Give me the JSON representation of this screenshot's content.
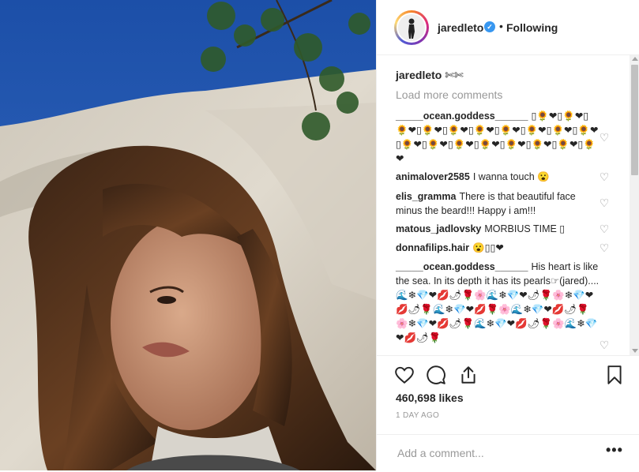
{
  "header": {
    "username": "jaredleto",
    "separator": "•",
    "follow_status": "Following"
  },
  "post": {
    "caption_user": "jaredleto",
    "caption_text": "✄✄",
    "load_more": "Load more comments",
    "likes": "460,698 likes",
    "timestamp": "1 DAY AGO",
    "add_comment_placeholder": "Add a comment...",
    "more_label": "•••"
  },
  "comments": [
    {
      "user": "_____ocean.goddess______",
      "text": "▯🌻❤▯🌻❤▯🌻❤▯🌻❤▯🌻❤▯🌻❤▯🌻❤▯🌻❤▯🌻❤▯🌻❤▯🌻❤▯🌻❤▯🌻❤▯🌻❤▯🌻❤▯🌻❤▯🌻❤▯🌻❤"
    },
    {
      "user": "animalover2585",
      "text": "I wanna touch 😮"
    },
    {
      "user": "elis_gramma",
      "text": "There is that beautiful face minus the beard!!! Happy i am!!!"
    },
    {
      "user": "matous_jadlovsky",
      "text": "MORBIUS TIME ▯"
    },
    {
      "user": "donnafilips.hair",
      "text": "😮▯▯❤"
    },
    {
      "user": "_____ocean.goddess______",
      "text": "His heart is like the sea. In its depth it has its pearls☞(jared)....🌊❄💎❤💋🌶🌹🌸🌊❄💎❤🌶🌹🌸❄💎❤💋🌶🌹🌊❄💎❤💋🌹🌸🌊❄💎❤💋🌶🌹🌸❄💎❤💋🌶🌹🌊❄💎❤💋🌶🌹🌸🌊❄💎❤💋🌶🌹"
    }
  ],
  "colors": {
    "link_blue": "#3897f0",
    "muted_gray": "#999999",
    "text": "#262626"
  }
}
